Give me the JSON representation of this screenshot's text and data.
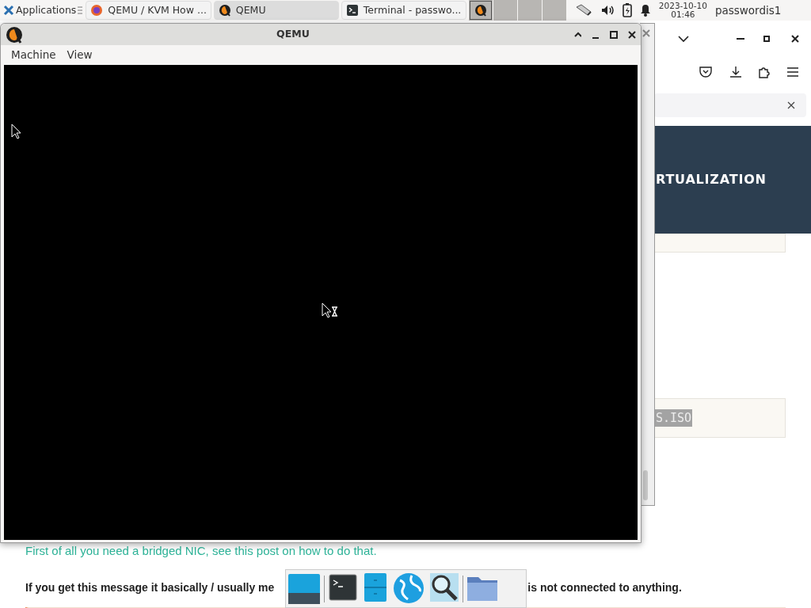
{
  "panel": {
    "apps_button": "Applications",
    "tasks": [
      {
        "label": "QEMU / KVM How ...",
        "kind": "browser",
        "selected": false
      },
      {
        "label": "QEMU",
        "kind": "qemu",
        "selected": true
      },
      {
        "label": "Terminal - passwo...",
        "kind": "terminal",
        "selected": false
      }
    ],
    "workspaces": [
      {
        "kind": "qemu",
        "selected": true
      },
      {
        "kind": "empty",
        "selected": false
      },
      {
        "kind": "empty",
        "selected": false
      },
      {
        "kind": "empty",
        "selected": false
      }
    ],
    "clock": {
      "date": "2023-10-10",
      "time": "01:46"
    },
    "user": "passwordis1"
  },
  "browser": {
    "heading": "RTUALIZATION",
    "code": "S.ISO",
    "link_paragraph": "First of all you need a bridged NIC, see this post on how to do that.",
    "bold_paragraph": [
      "If you get this message it basically / usually me",
      "is not connected to anything."
    ]
  },
  "qemu": {
    "title": "QEMU",
    "menus": [
      "Machine",
      "View"
    ]
  },
  "dock": [
    {
      "kind": "desktop"
    },
    {
      "kind": "terminal"
    },
    {
      "kind": "cabinet"
    },
    {
      "kind": "globe"
    },
    {
      "kind": "search"
    },
    {
      "kind": "folder"
    }
  ]
}
